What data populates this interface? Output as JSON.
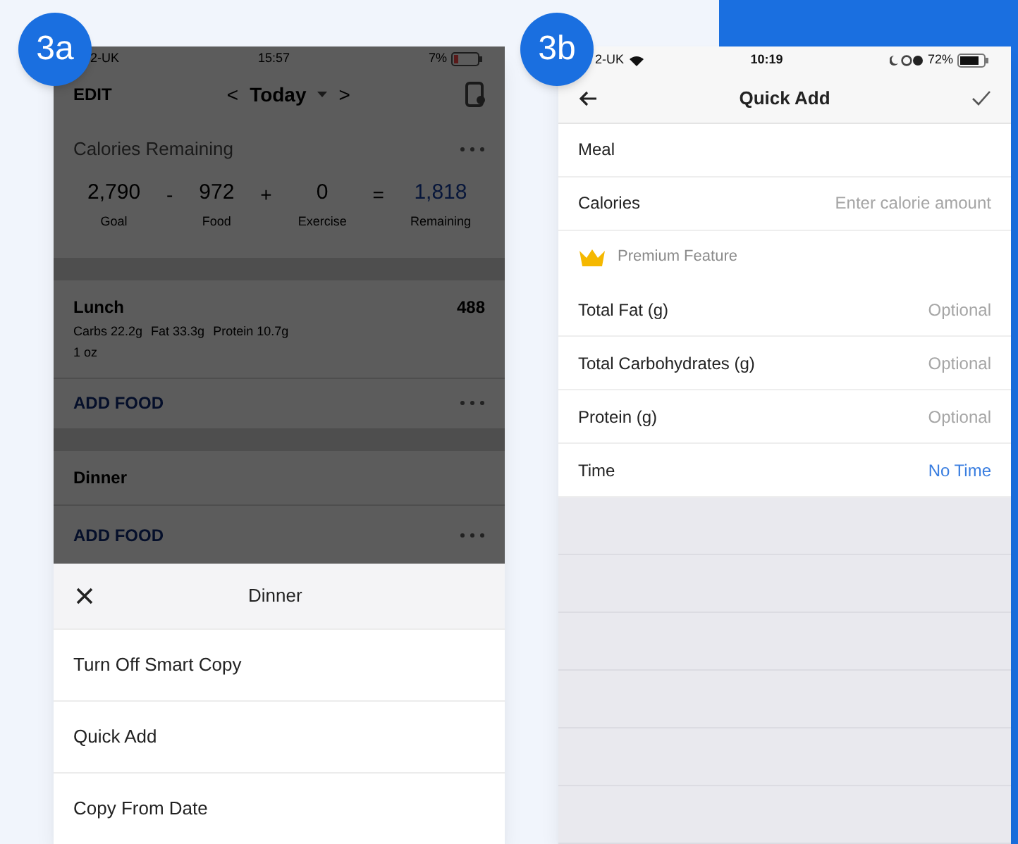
{
  "left_screen": {
    "badge": "3a",
    "status_bar": {
      "carrier": "2-UK",
      "time": "15:57",
      "battery": "7%"
    },
    "nav": {
      "edit": "EDIT",
      "prev": "<",
      "date": "Today",
      "next": ">"
    },
    "calories": {
      "title": "Calories Remaining",
      "items": [
        {
          "kind": "term",
          "value": "2,790",
          "label": "Goal"
        },
        {
          "kind": "operator",
          "value": "-"
        },
        {
          "kind": "term",
          "value": "972",
          "label": "Food"
        },
        {
          "kind": "operator",
          "value": "+"
        },
        {
          "kind": "term",
          "value": "0",
          "label": "Exercise"
        },
        {
          "kind": "operator",
          "value": "="
        },
        {
          "kind": "result",
          "value": "1,818",
          "label": "Remaining"
        }
      ]
    },
    "meals": [
      {
        "name": "Lunch",
        "calories": "488",
        "macros": [
          "Carbs 22.2g",
          "Fat 33.3g",
          "Protein 10.7g"
        ],
        "serving": "1 oz",
        "action": "ADD FOOD"
      },
      {
        "name": "Dinner",
        "action": "ADD FOOD"
      }
    ],
    "sheet": {
      "title": "Dinner",
      "items": [
        "Turn Off Smart Copy",
        "Quick Add",
        "Copy From Date"
      ]
    }
  },
  "right_screen": {
    "badge": "3b",
    "status_bar": {
      "carrier": "2-UK",
      "time": "10:19",
      "battery": "72%"
    },
    "title": "Quick Add",
    "rows": [
      {
        "kind": "field",
        "label": "Meal"
      },
      {
        "kind": "field",
        "label": "Calories",
        "placeholder": "Enter calorie amount"
      },
      {
        "kind": "premium",
        "label": "Premium Feature"
      },
      {
        "kind": "field",
        "label": "Total Fat (g)",
        "placeholder": "Optional"
      },
      {
        "kind": "field",
        "label": "Total Carbohydrates (g)",
        "placeholder": "Optional"
      },
      {
        "kind": "field",
        "label": "Protein (g)",
        "placeholder": "Optional"
      },
      {
        "kind": "link",
        "label": "Time",
        "value": "No Time"
      }
    ]
  }
}
